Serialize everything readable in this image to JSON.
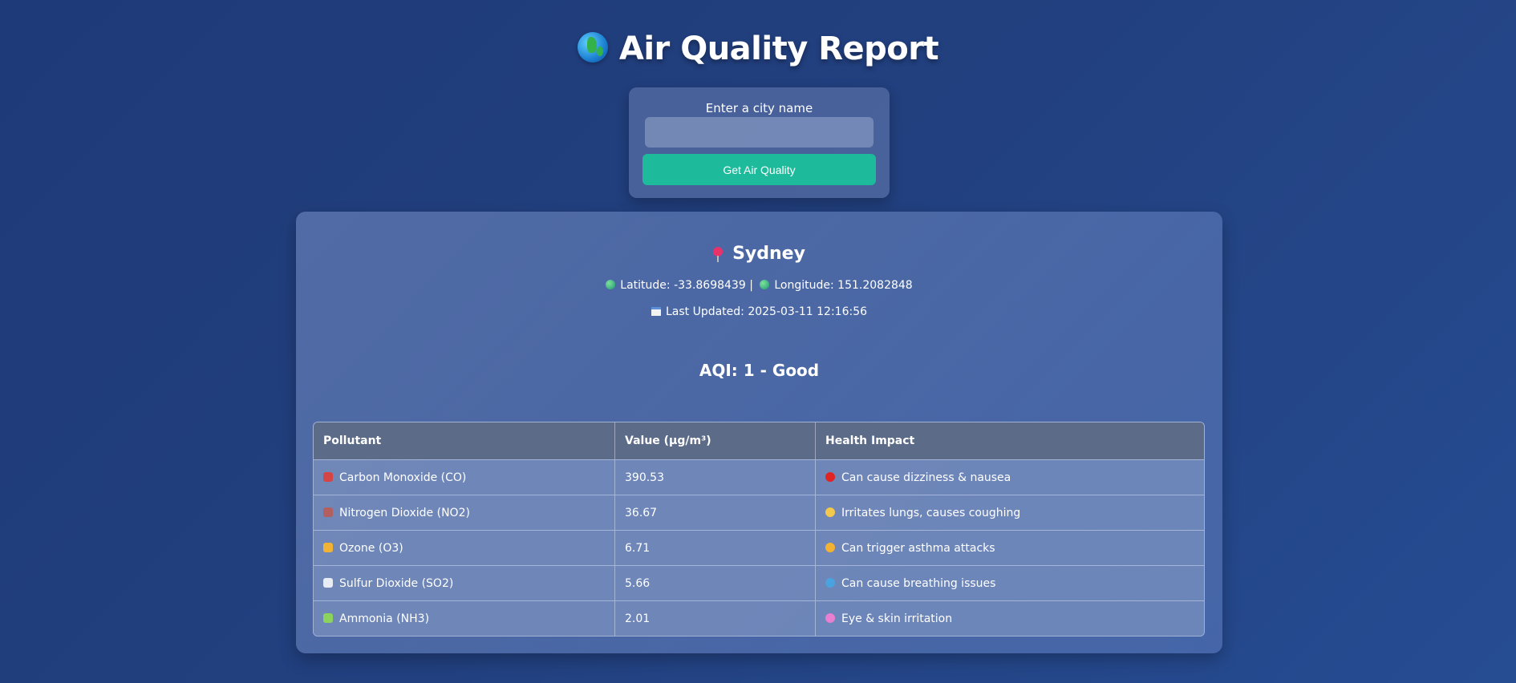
{
  "header": {
    "icon": "globe-icon",
    "title": "Air Quality Report"
  },
  "search": {
    "label": "Enter a city name",
    "value": "",
    "placeholder": "",
    "button_label": "Get Air Quality"
  },
  "result": {
    "city_icon": "pin-icon",
    "city": "Sydney",
    "latitude_label": "Latitude: -33.8698439 |",
    "longitude_label": "Longitude: 151.2082848",
    "updated_label": "Last Updated: 2025-03-11 12:16:56",
    "aqi_label": "AQI: 1 - Good"
  },
  "table": {
    "headers": [
      "Pollutant",
      "Value (µg/m³)",
      "Health Impact"
    ],
    "rows": [
      {
        "icon": "car-icon",
        "icon_color": "#d64545",
        "pollutant": "Carbon Monoxide (CO)",
        "value": "390.53",
        "impact_icon": "red-circle-icon",
        "impact_color": "#e02424",
        "impact": "Can cause dizziness & nausea"
      },
      {
        "icon": "factory-icon",
        "icon_color": "#b35f5f",
        "pollutant": "Nitrogen Dioxide (NO2)",
        "value": "36.67",
        "impact_icon": "grimace-face-icon",
        "impact_color": "#f2c94c",
        "impact": "Irritates lungs, causes coughing"
      },
      {
        "icon": "sun-face-icon",
        "icon_color": "#f2b233",
        "pollutant": "Ozone (O3)",
        "value": "6.71",
        "impact_icon": "sun-icon",
        "impact_color": "#f2b233",
        "impact": "Can trigger asthma attacks"
      },
      {
        "icon": "cloud-icon",
        "icon_color": "#e8ecf4",
        "pollutant": "Sulfur Dioxide (SO2)",
        "value": "5.66",
        "impact_icon": "wind-face-icon",
        "impact_color": "#4aa3df",
        "impact": "Can cause breathing issues"
      },
      {
        "icon": "test-tube-icon",
        "icon_color": "#8bd35c",
        "pollutant": "Ammonia (NH3)",
        "value": "2.01",
        "impact_icon": "eye-icon",
        "impact_color": "#e87fd0",
        "impact": "Eye & skin irritation"
      }
    ]
  },
  "colors": {
    "background": "#22407f",
    "accent": "#1dbb9b"
  }
}
